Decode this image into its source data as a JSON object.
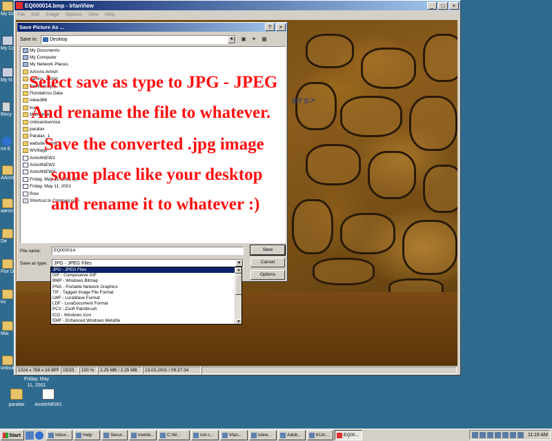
{
  "desktop": {
    "left_icons": [
      {
        "label": "My Do",
        "icon": "folder-icon"
      },
      {
        "label": "My Co",
        "icon": "computer-icon"
      },
      {
        "label": "My N P",
        "icon": "network-icon"
      },
      {
        "label": "Recy",
        "icon": "recycle-bin-icon"
      },
      {
        "label": "Int E",
        "icon": "internet-explorer-icon"
      },
      {
        "label": "AAron",
        "icon": "folder-icon"
      },
      {
        "label": "aaron",
        "icon": "folder-icon"
      },
      {
        "label": "De",
        "icon": "folder-icon"
      },
      {
        "label": "Flor D",
        "icon": "folder-icon"
      },
      {
        "label": "ku",
        "icon": "folder-icon"
      },
      {
        "label": "Mai",
        "icon": "folder-icon"
      },
      {
        "label": "onboardserv",
        "icon": "folder-icon"
      }
    ],
    "bottom_icons": [
      {
        "label": "paralax",
        "icon": "folder-icon"
      },
      {
        "label": "AmishNEW1",
        "icon": "document-icon"
      }
    ],
    "behind_text": "Friday, May 11, 2001"
  },
  "irfanview": {
    "title": "EQ000014.bmp - IrfanView",
    "menu": [
      "File",
      "Edit",
      "Image",
      "Options",
      "View",
      "Help"
    ],
    "status": [
      "1024 x 768 x 24 BPP",
      "15/20",
      "100 %",
      "2.25 MB / 2.25 MB",
      "13.03.2001 / 09:37:34"
    ],
    "behind_text": "ers>"
  },
  "dialog": {
    "title": "Save Picture As ...",
    "save_in_label": "Save in:",
    "save_in_value": "Desktop",
    "files": [
      {
        "name": "My Documents",
        "type": "sys"
      },
      {
        "name": "My Computer",
        "type": "sys"
      },
      {
        "name": "My Network Places",
        "type": "sys"
      },
      {
        "name": "AArons Amish",
        "type": "folder"
      },
      {
        "name": "aarons_amish",
        "type": "folder"
      },
      {
        "name": "Desktop April",
        "type": "folder"
      },
      {
        "name": "FloridaKiss Data",
        "type": "folder"
      },
      {
        "name": "iview386",
        "type": "folder"
      },
      {
        "name": "kua",
        "type": "folder"
      },
      {
        "name": "Mainstreet",
        "type": "folder"
      },
      {
        "name": "onboardservice",
        "type": "folder"
      },
      {
        "name": "paralax",
        "type": "folder"
      },
      {
        "name": "Paralax_1",
        "type": "folder"
      },
      {
        "name": "website name",
        "type": "folder"
      },
      {
        "name": "WVillage",
        "type": "folder"
      },
      {
        "name": "AmishNEW1",
        "type": "doc"
      },
      {
        "name": "AmishNEW2",
        "type": "doc"
      },
      {
        "name": "AmishNEW3",
        "type": "doc"
      },
      {
        "name": "Friday, May 11, 2001 (2)",
        "type": "doc"
      },
      {
        "name": "Friday, May 11, 2001",
        "type": "doc"
      },
      {
        "name": "Row",
        "type": "doc"
      },
      {
        "name": "Shortcut to Compaq.com",
        "type": "short"
      }
    ],
    "file_name_label": "File name:",
    "file_name_value": "EQ000014",
    "save_as_type_label": "Save as type:",
    "save_as_type_value": "JPG - JPEG Files",
    "save_button": "Save",
    "cancel_button": "Cancel",
    "options_button": "Options",
    "type_options": [
      "JPG - JPEG Files",
      "GIF - Compuserve GIF",
      "BMP - Windows Bitmap",
      "PNG - Portable Network Graphics",
      "TIF - Tagged Image File Format",
      "LWF - LuraWave Format",
      "LDF - LuraDocument Format",
      "PCX - Zsoft Paintbrush",
      "ICO - Windows Icon",
      "EMF - Enhanced Windows Metafile"
    ]
  },
  "instructions": [
    "Select save as type to JPG - JPEG",
    "And rename the file to whatever.",
    "Save the converted .jpg image",
    "some place like your desktop",
    "and rename it to whatever :)"
  ],
  "taskbar": {
    "start_label": "Start",
    "tasks": [
      {
        "label": "Inbox...",
        "active": false
      },
      {
        "label": "Help",
        "active": false
      },
      {
        "label": "Secur...",
        "active": false
      },
      {
        "label": "memb...",
        "active": false
      },
      {
        "label": "C:\\W...",
        "active": false
      },
      {
        "label": "not c...",
        "active": false
      },
      {
        "label": "Irfan...",
        "active": false
      },
      {
        "label": "iview...",
        "active": false
      },
      {
        "label": "Adob...",
        "active": false
      },
      {
        "label": "KUA...",
        "active": false
      },
      {
        "label": "EQ00...",
        "active": true
      }
    ],
    "clock": "11:19 AM"
  }
}
